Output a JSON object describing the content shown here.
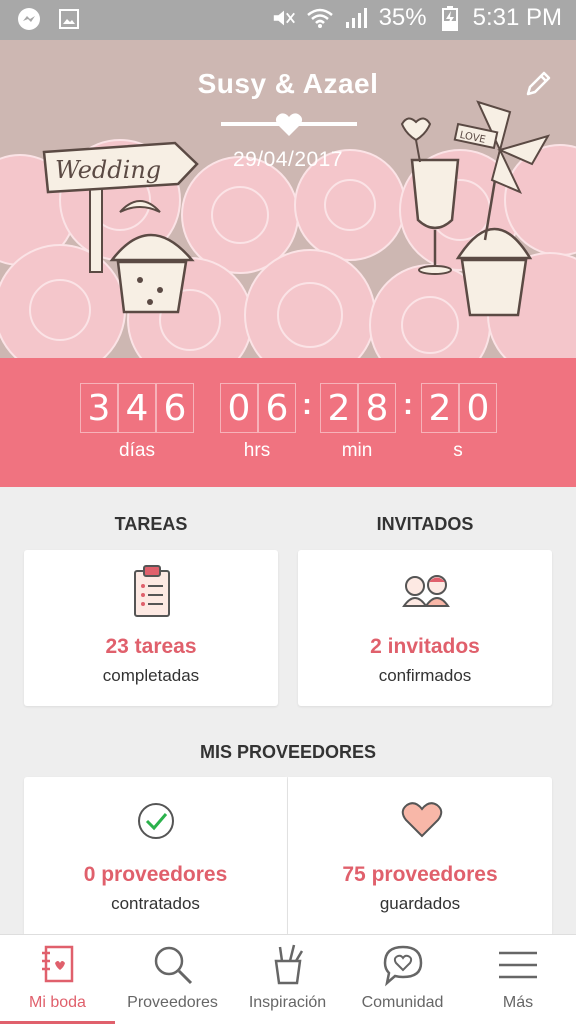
{
  "status_bar": {
    "battery": "35%",
    "time": "5:31 PM",
    "icons": [
      "messenger-icon",
      "gallery-icon",
      "mute-icon",
      "wifi-icon",
      "signal-icon",
      "battery-charging-icon"
    ]
  },
  "header": {
    "couple_names": "Susy & Azael",
    "wedding_date": "29/04/2017",
    "illustration_sign_text": "Wedding",
    "illustration_pinwheel_text": "LOVE"
  },
  "countdown": {
    "days": [
      "3",
      "4",
      "6"
    ],
    "hours": [
      "0",
      "6"
    ],
    "minutes": [
      "2",
      "8"
    ],
    "seconds": [
      "2",
      "0"
    ],
    "labels": {
      "days": "días",
      "hours": "hrs",
      "minutes": "min",
      "seconds": "s"
    }
  },
  "tareas": {
    "title": "TAREAS",
    "count": "23 tareas",
    "subtitle": "completadas"
  },
  "invitados": {
    "title": "INVITADOS",
    "count": "2 invitados",
    "subtitle": "confirmados"
  },
  "proveedores": {
    "title": "MIS PROVEEDORES",
    "contratados_count": "0 proveedores",
    "contratados_label": "contratados",
    "guardados_count": "75 proveedores",
    "guardados_label": "guardados"
  },
  "nav": {
    "items": [
      {
        "label": "Mi boda",
        "icon": "notebook-icon",
        "active": true
      },
      {
        "label": "Proveedores",
        "icon": "search-icon",
        "active": false
      },
      {
        "label": "Inspiración",
        "icon": "inspiration-cup-icon",
        "active": false
      },
      {
        "label": "Comunidad",
        "icon": "chat-heart-icon",
        "active": false
      },
      {
        "label": "Más",
        "icon": "menu-icon",
        "active": false
      }
    ]
  },
  "colors": {
    "accent": "#f07380",
    "accent_text": "#e0606c",
    "hero_bg": "#cdb7b2",
    "roses": "#f4c6cb",
    "page_bg": "#eeeeee"
  }
}
